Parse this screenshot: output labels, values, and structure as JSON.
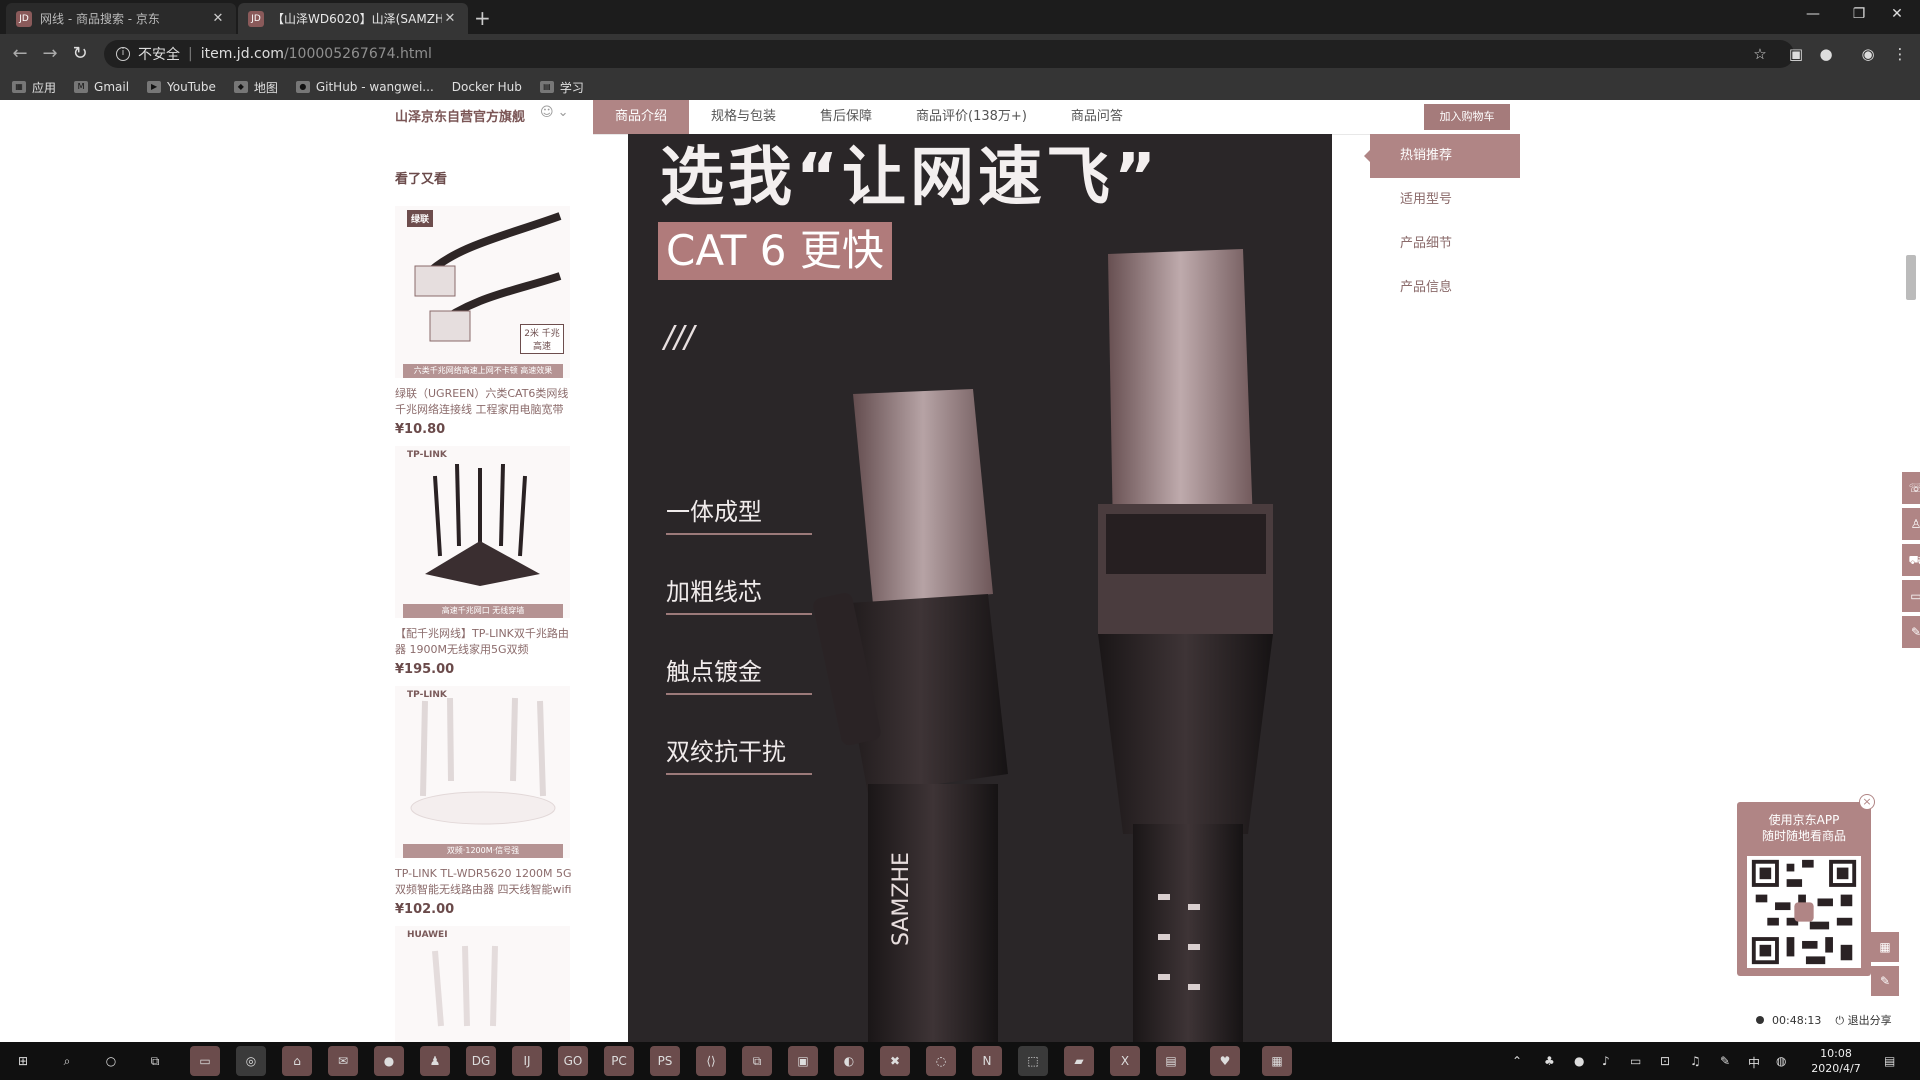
{
  "browser": {
    "tabs": [
      {
        "title": "网线 - 商品搜索 - 京东",
        "favicon": "JD"
      },
      {
        "title": "【山泽WD6020】山泽(SAMZH",
        "favicon": "JD"
      }
    ],
    "url": {
      "insecure_label": "不安全",
      "domain": "item.jd.com",
      "path": "/100005267674.html"
    },
    "bookmarks": [
      "应用",
      "Gmail",
      "YouTube",
      "地图",
      "GitHub - wangwei...",
      "Docker Hub",
      "学习"
    ]
  },
  "product_nav": {
    "shop_name": "山泽京东自营官方旗舰",
    "tabs": [
      "商品介绍",
      "规格与包装",
      "售后保障",
      "商品评价(138万+)",
      "商品问答"
    ],
    "cart_button": "加入购物车"
  },
  "see_also": {
    "heading": "看了又看",
    "items": [
      {
        "brand_tag": "绿联",
        "badge": "2米 千兆高速",
        "ribbon": "六类千兆网络高速上网不卡顿 高速效果",
        "name": "绿联（UGREEN）六类CAT6类网线 千兆网络连接线 工程家用电脑宽带",
        "price": "¥10.80"
      },
      {
        "brand_tag": "TP-LINK",
        "ribbon": "高速千兆网口 无线穿墙",
        "name": "【配千兆网线】TP-LINK双千兆路由器 1900M无线家用5G双频",
        "price": "¥195.00"
      },
      {
        "brand_tag": "TP-LINK",
        "ribbon": "双频·1200M·信号强",
        "name": "TP-LINK TL-WDR5620 1200M 5G双频智能无线路由器 四天线智能wifi",
        "price": "¥102.00"
      },
      {
        "brand_tag": "HUAWEI"
      }
    ]
  },
  "hero": {
    "title": "选我“让网速飞”",
    "badge": "CAT 6 更快",
    "slash": "///",
    "features": [
      "一体成型",
      "加粗线芯",
      "触点镀金",
      "双绞抗干扰"
    ],
    "cable_print": "SAMZHE"
  },
  "side_nav": {
    "items": [
      "热销推荐",
      "适用型号",
      "产品细节",
      "产品信息"
    ]
  },
  "qr_widget": {
    "line1": "使用京东APP",
    "line2": "随时随地看商品",
    "close": "×"
  },
  "recording": {
    "time": "00:48:13",
    "share": "退出分享"
  },
  "taskbar": {
    "time": "10:08",
    "date": "2020/4/7",
    "ime": "中"
  }
}
